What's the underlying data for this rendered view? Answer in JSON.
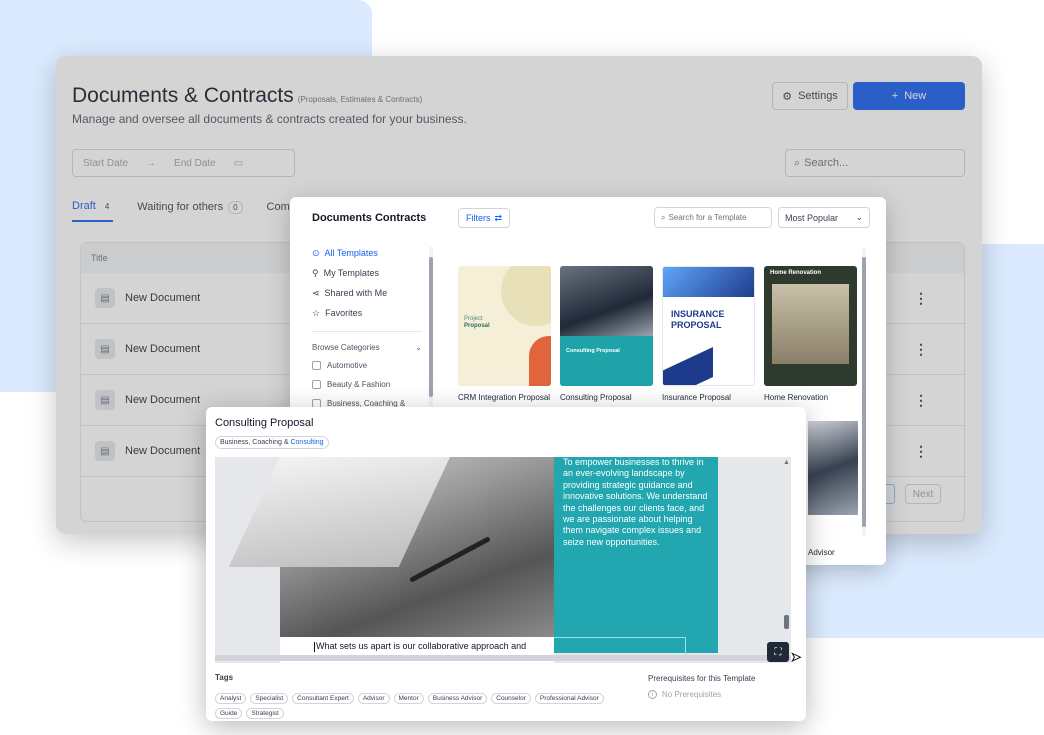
{
  "back": {
    "title": "Documents & Contracts",
    "title_note": "(Proposals, Estimates & Contracts)",
    "subtitle": "Manage and oversee all documents & contracts created for your business.",
    "settings_label": "Settings",
    "new_label": "New",
    "start_date": "Start Date",
    "arrow": "→",
    "end_date": "End Date",
    "search_placeholder": "Search...",
    "tabs": [
      {
        "label": "Draft",
        "count": "4"
      },
      {
        "label": "Waiting for others",
        "count": "0"
      },
      {
        "label": "Comp",
        "count": ""
      }
    ],
    "table_header": "Title",
    "rows": [
      {
        "name": "New Document"
      },
      {
        "name": "New Document"
      },
      {
        "name": "New Document"
      },
      {
        "name": "New Document"
      }
    ],
    "next_label": "Next"
  },
  "gallery": {
    "title": "Documents Contracts",
    "filters_label": "Filters",
    "search_placeholder": "Search for a Template",
    "sort_value": "Most Popular",
    "nav": [
      {
        "label": "All Templates",
        "icon": "grid-icon"
      },
      {
        "label": "My Templates",
        "icon": "user-icon"
      },
      {
        "label": "Shared with Me",
        "icon": "share-icon"
      },
      {
        "label": "Favorites",
        "icon": "star-icon"
      }
    ],
    "browse_label": "Browse Categories",
    "categories": [
      "Automotive",
      "Beauty & Fashion",
      "Business, Coaching &"
    ],
    "cards": [
      {
        "label": "CRM Integration Proposal",
        "thumb_line1": "Project",
        "thumb_line2": "Proposal"
      },
      {
        "label": "Consulting Proposal",
        "thumb_text": "Consulting Proposal"
      },
      {
        "label": "Insurance Proposal",
        "thumb_text": "INSURANCE PROPOSAL"
      },
      {
        "label": "Home Renovation",
        "thumb_text": "Home Renovation"
      }
    ],
    "partial_card_label": "Advisor"
  },
  "preview": {
    "title": "Consulting Proposal",
    "category_prefix": "Business, Coaching &",
    "category_highlight": "Consulting",
    "teal_text": "To empower businesses to thrive in an ever-evolving landscape by providing strategic guidance and innovative solutions. We understand the challenges our clients face, and we are passionate about helping them navigate complex issues and seize new opportunities.",
    "bottom_text": "What sets us apart is our collaborative approach and",
    "tags_title": "Tags",
    "tags": [
      "Analyst",
      "Specialist",
      "Consultant Expert",
      "Advisor",
      "Mentor",
      "Business Advisor",
      "Counselor",
      "Professional Advisor",
      "Guide",
      "Strategist"
    ],
    "prereq_title": "Prerequisites for this Template",
    "prereq_value": "No Prerequisites"
  },
  "colors": {
    "accent": "#155eef",
    "teal": "#22a7b0",
    "backdrop_blob": "#dbeafe"
  }
}
